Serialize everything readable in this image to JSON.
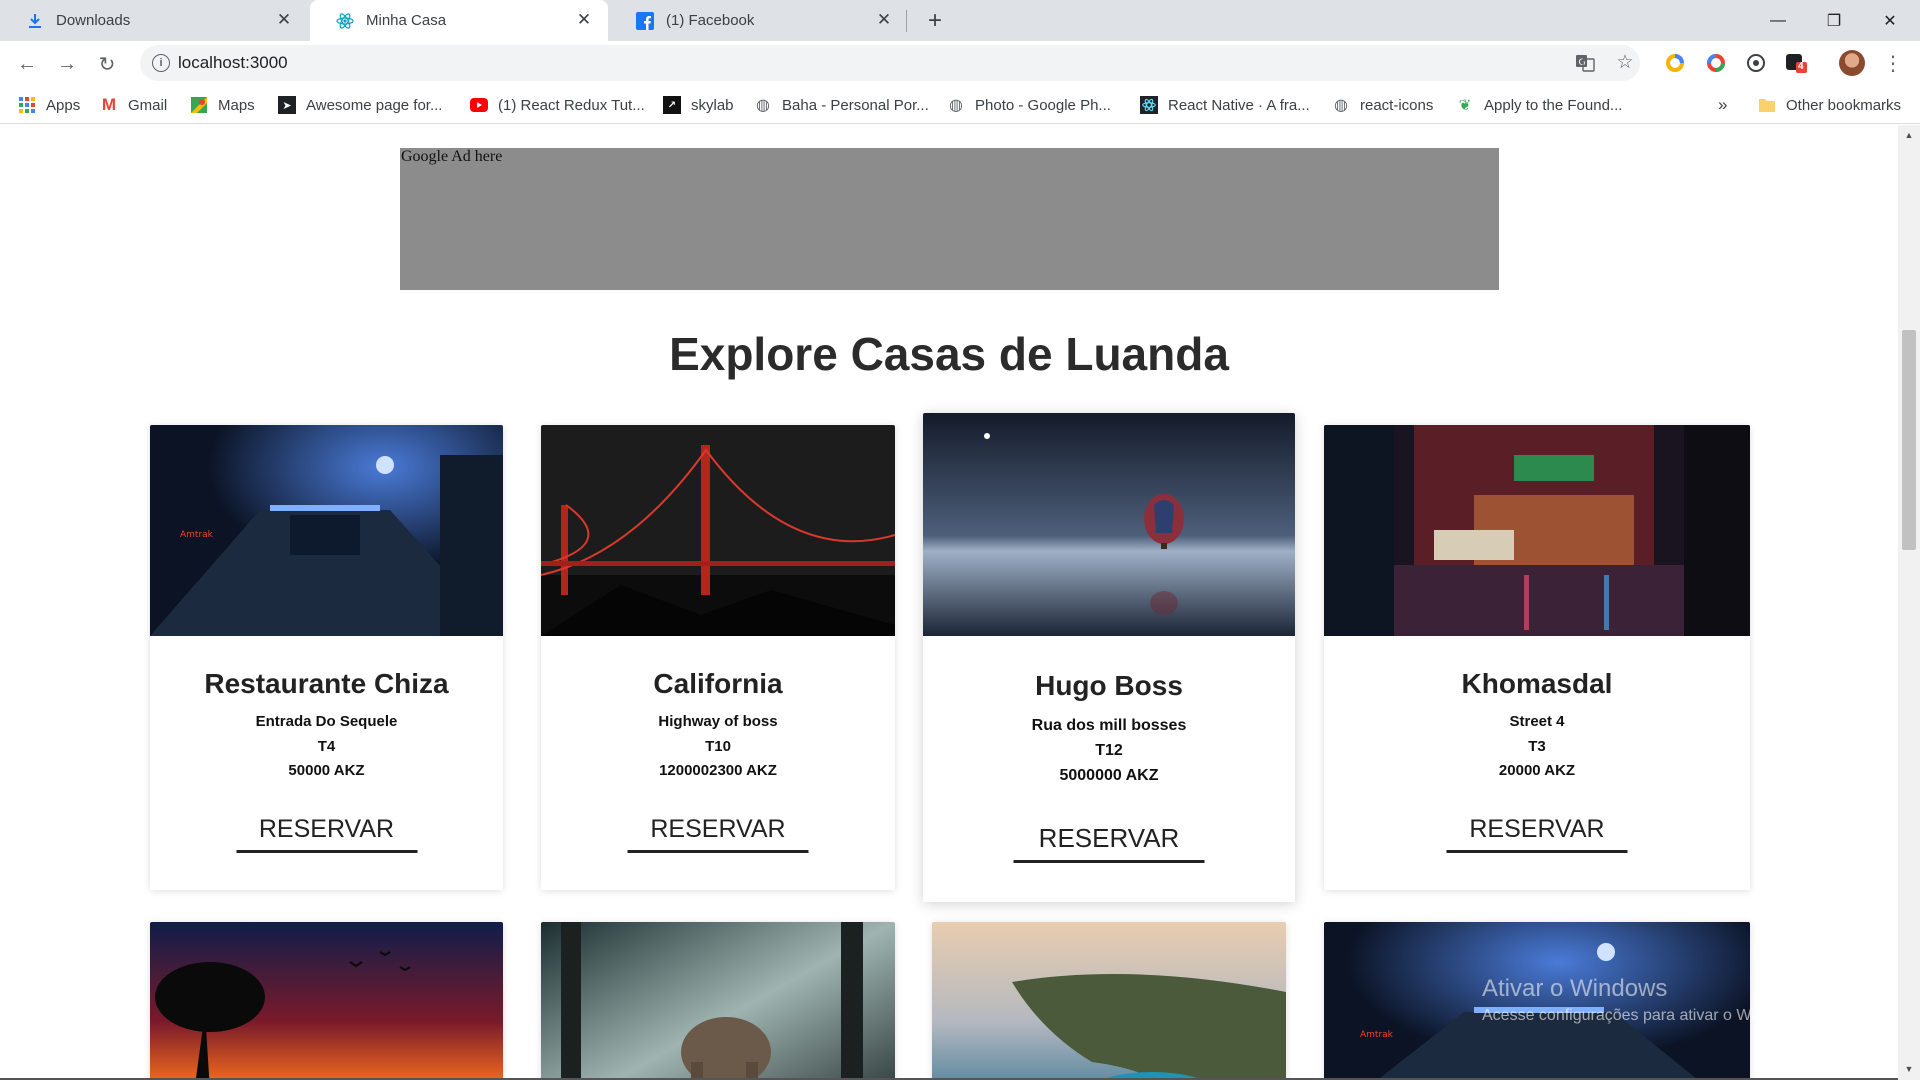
{
  "browser": {
    "tabs": [
      {
        "title": "Downloads",
        "icon": "download-icon"
      },
      {
        "title": "Minha Casa",
        "icon": "react-icon"
      },
      {
        "title": "(1) Facebook",
        "icon": "facebook-icon"
      }
    ],
    "url": "localhost:3000",
    "bookmarks": [
      {
        "label": "Apps",
        "icon": "apps-grid-icon"
      },
      {
        "label": "Gmail",
        "icon": "gmail-icon"
      },
      {
        "label": "Maps",
        "icon": "maps-icon"
      },
      {
        "label": "Awesome page for...",
        "icon": "bookmark-arrow-icon"
      },
      {
        "label": "(1) React Redux Tut...",
        "icon": "youtube-icon"
      },
      {
        "label": "skylab",
        "icon": "skylab-icon"
      },
      {
        "label": "Baha - Personal Por...",
        "icon": "globe-icon"
      },
      {
        "label": "Photo - Google Ph...",
        "icon": "globe-icon"
      },
      {
        "label": "React Native · A fra...",
        "icon": "react-icon"
      },
      {
        "label": "react-icons",
        "icon": "globe-icon"
      },
      {
        "label": "Apply to the Found...",
        "icon": "leaf-icon"
      }
    ],
    "bookmarks_overflow": "»",
    "other_bookmarks": "Other bookmarks",
    "extension_badge": "4"
  },
  "page": {
    "ad_text": "Google Ad here",
    "title": "Explore Casas de Luanda",
    "cards": [
      {
        "name": "Restaurante Chiza",
        "street": "Entrada Do Sequele",
        "typology": "T4",
        "price": "50000 AKZ",
        "button": "RESERVAR",
        "photo": "night-walkway-photo"
      },
      {
        "name": "California",
        "street": "Highway of boss",
        "typology": "T10",
        "price": "1200002300 AKZ",
        "button": "RESERVAR",
        "photo": "golden-gate-bridge-photo"
      },
      {
        "name": "Hugo Boss",
        "street": "Rua dos mill bosses",
        "typology": "T12",
        "price": "5000000 AKZ",
        "button": "RESERVAR",
        "photo": "hot-air-balloon-photo"
      },
      {
        "name": "Khomasdal",
        "street": "Street 4",
        "typology": "T3",
        "price": "20000 AKZ",
        "button": "RESERVAR",
        "photo": "neon-street-photo"
      }
    ],
    "second_row_photos": [
      "sunset-tree-photo",
      "elephant-forest-photo",
      "coastal-cliff-photo",
      "night-walkway-photo"
    ]
  },
  "overlay": {
    "windows_activation_title": "Ativar o Windows",
    "windows_activation_text": "Acesse configurações para ativar o Windows."
  },
  "colors": {
    "tabstrip": "#dee1e6",
    "ad_background": "#8c8c8c",
    "text_dark": "#222222"
  }
}
